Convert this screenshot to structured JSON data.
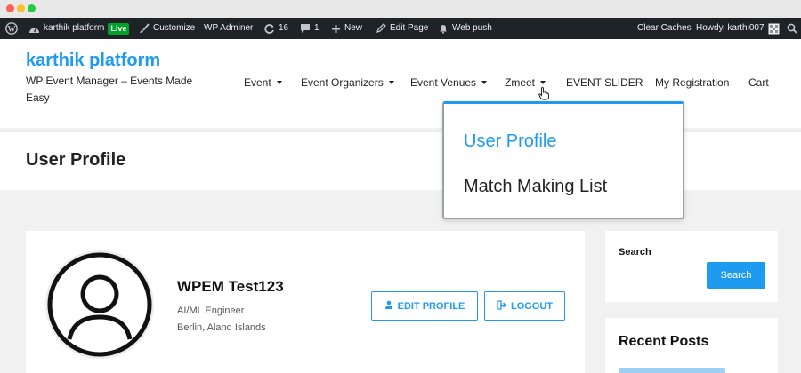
{
  "admin_bar": {
    "site_name": "karthik platform",
    "live_badge": "Live",
    "customize": "Customize",
    "wp_adminer": "WP Adminer",
    "updates_count": "16",
    "comments_count": "1",
    "new": "New",
    "edit_page": "Edit Page",
    "web_push": "Web push",
    "clear_caches": "Clear Caches",
    "howdy": "Howdy, karthi007"
  },
  "header": {
    "site_title": "karthik platform",
    "tagline": "WP Event Manager – Events Made Easy"
  },
  "nav": [
    {
      "label": "Event"
    },
    {
      "label": "Event Organizers"
    },
    {
      "label": "Event Venues"
    },
    {
      "label": "Zmeet"
    },
    {
      "label": "EVENT SLIDER"
    },
    {
      "label": "My Registration"
    },
    {
      "label": "Cart"
    }
  ],
  "dropdown": {
    "items": [
      {
        "label": "User Profile",
        "active": true
      },
      {
        "label": "Match Making List",
        "active": false
      }
    ]
  },
  "page": {
    "title": "User Profile"
  },
  "profile": {
    "name": "WPEM Test123",
    "job": "AI/ML Engineer",
    "location": "Berlin, Aland Islands",
    "edit_button": "EDIT PROFILE",
    "logout_button": "LOGOUT"
  },
  "sidebar": {
    "search_label": "Search",
    "search_button": "Search",
    "recent_posts_heading": "Recent Posts"
  },
  "colors": {
    "accent": "#1e9bf0",
    "admin_bar": "#1d2327",
    "live_badge": "#00a32a"
  }
}
